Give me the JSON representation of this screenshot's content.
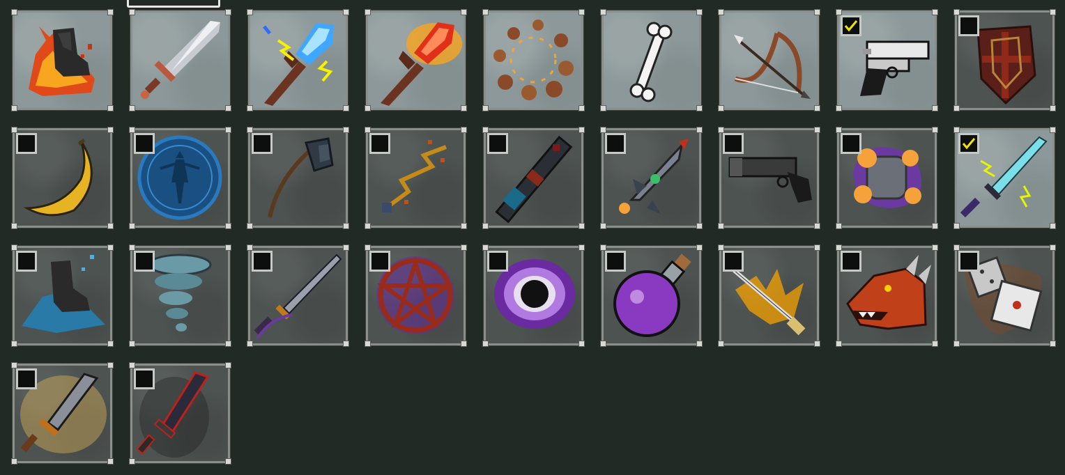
{
  "colors": {
    "background": "#222a26",
    "slot_owned": "#8c9899",
    "slot_unowned": "#4d5351",
    "slot_border": "#8a8f8c",
    "checkmark": "#f2e400",
    "checkbox_fill": "#0d0f0e"
  },
  "items": [
    {
      "icon": "flaming-boot-icon",
      "owned": true,
      "checkbox": false,
      "checked": false
    },
    {
      "icon": "steel-sword-icon",
      "owned": true,
      "checkbox": false,
      "checked": false
    },
    {
      "icon": "lightning-staff-icon",
      "owned": true,
      "checkbox": false,
      "checked": false
    },
    {
      "icon": "fire-staff-icon",
      "owned": true,
      "checkbox": false,
      "checked": false
    },
    {
      "icon": "orbiting-rocks-icon",
      "owned": true,
      "checkbox": false,
      "checked": false
    },
    {
      "icon": "bone-icon",
      "owned": true,
      "checkbox": false,
      "checked": false
    },
    {
      "icon": "crossbow-icon",
      "owned": true,
      "checkbox": false,
      "checked": false
    },
    {
      "icon": "revolver-icon",
      "owned": true,
      "checkbox": true,
      "checked": true
    },
    {
      "icon": "cross-shield-icon",
      "owned": false,
      "checkbox": true,
      "checked": false
    },
    {
      "icon": "banana-icon",
      "owned": false,
      "checkbox": true,
      "checked": false
    },
    {
      "icon": "spirit-orb-icon",
      "owned": false,
      "checkbox": true,
      "checked": false
    },
    {
      "icon": "battle-axe-icon",
      "owned": false,
      "checkbox": true,
      "checked": false
    },
    {
      "icon": "zigzag-wand-icon",
      "owned": false,
      "checkbox": true,
      "checked": false
    },
    {
      "icon": "rocket-launcher-icon",
      "owned": false,
      "checkbox": true,
      "checked": false
    },
    {
      "icon": "rocket-ship-icon",
      "owned": false,
      "checkbox": true,
      "checked": false
    },
    {
      "icon": "blunderbuss-icon",
      "owned": false,
      "checkbox": true,
      "checked": false
    },
    {
      "icon": "orb-cluster-icon",
      "owned": false,
      "checkbox": true,
      "checked": false
    },
    {
      "icon": "electric-dagger-icon",
      "owned": true,
      "checkbox": true,
      "checked": true
    },
    {
      "icon": "frost-boot-icon",
      "owned": false,
      "checkbox": true,
      "checked": false
    },
    {
      "icon": "tornado-icon",
      "owned": false,
      "checkbox": true,
      "checked": false
    },
    {
      "icon": "shadow-blade-icon",
      "owned": false,
      "checkbox": true,
      "checked": false
    },
    {
      "icon": "pentagram-icon",
      "owned": false,
      "checkbox": true,
      "checked": false
    },
    {
      "icon": "black-hole-icon",
      "owned": false,
      "checkbox": true,
      "checked": false
    },
    {
      "icon": "potion-flask-icon",
      "owned": false,
      "checkbox": true,
      "checked": false
    },
    {
      "icon": "katana-slash-icon",
      "owned": false,
      "checkbox": true,
      "checked": false
    },
    {
      "icon": "dragon-head-icon",
      "owned": false,
      "checkbox": true,
      "checked": false
    },
    {
      "icon": "dice-icon",
      "owned": false,
      "checkbox": true,
      "checked": false
    },
    {
      "icon": "golden-glow-sword-icon",
      "owned": false,
      "checkbox": true,
      "checked": false
    },
    {
      "icon": "blood-sword-icon",
      "owned": false,
      "checkbox": true,
      "checked": false
    }
  ]
}
